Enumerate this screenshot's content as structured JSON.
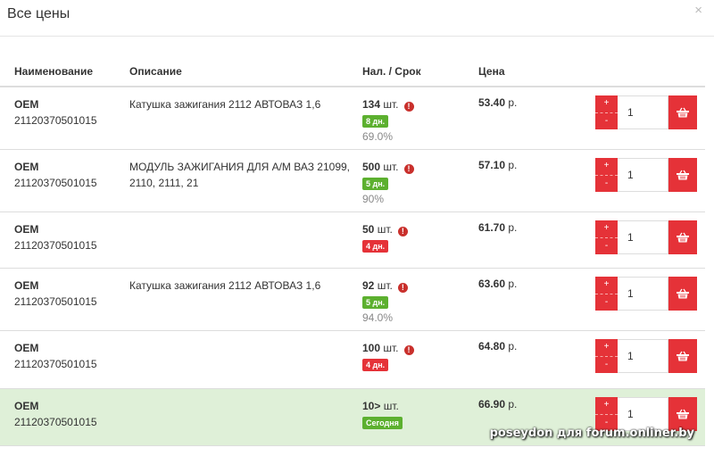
{
  "title": "Все цены",
  "close": "×",
  "headers": {
    "name": "Наименование",
    "desc": "Описание",
    "stock": "Нал. / Срок",
    "price": "Цена"
  },
  "colors": {
    "accent": "#e53238",
    "green": "#5cb02f",
    "red": "#e53238",
    "highlight": "#dff0d8"
  },
  "rows": [
    {
      "brand": "OEM",
      "code": "21120370501015",
      "desc": "Катушка зажигания 2112 АВТОВАЗ 1,6",
      "qty": "134",
      "unit": "шт.",
      "warn": true,
      "term": "8 дн.",
      "term_color": "#5cb02f",
      "pct": "69.0%",
      "price": "53.40",
      "cur": "р.",
      "amount": "1",
      "highlight": false
    },
    {
      "brand": "OEM",
      "code": "21120370501015",
      "desc": "МОДУЛЬ ЗАЖИГАНИЯ ДЛЯ А/М ВАЗ 21099, 2110, 2111, 21",
      "qty": "500",
      "unit": "шт.",
      "warn": true,
      "term": "5 дн.",
      "term_color": "#5cb02f",
      "pct": "90%",
      "price": "57.10",
      "cur": "р.",
      "amount": "1",
      "highlight": false
    },
    {
      "brand": "OEM",
      "code": "21120370501015",
      "desc": "",
      "qty": "50",
      "unit": "шт.",
      "warn": true,
      "term": "4 дн.",
      "term_color": "#e53238",
      "pct": "",
      "price": "61.70",
      "cur": "р.",
      "amount": "1",
      "highlight": false
    },
    {
      "brand": "OEM",
      "code": "21120370501015",
      "desc": "Катушка зажигания 2112 АВТОВАЗ 1,6",
      "qty": "92",
      "unit": "шт.",
      "warn": true,
      "term": "5 дн.",
      "term_color": "#5cb02f",
      "pct": "94.0%",
      "price": "63.60",
      "cur": "р.",
      "amount": "1",
      "highlight": false
    },
    {
      "brand": "OEM",
      "code": "21120370501015",
      "desc": "",
      "qty": "100",
      "unit": "шт.",
      "warn": true,
      "term": "4 дн.",
      "term_color": "#e53238",
      "pct": "",
      "price": "64.80",
      "cur": "р.",
      "amount": "1",
      "highlight": false
    },
    {
      "brand": "OEM",
      "code": "21120370501015",
      "desc": "",
      "qty": "10>",
      "unit": "шт.",
      "warn": false,
      "term": "Сегодня",
      "term_color": "#5cb02f",
      "pct": "",
      "price": "66.90",
      "cur": "р.",
      "amount": "1",
      "highlight": true
    }
  ],
  "plus": "+",
  "minus": "-",
  "watermark": "poseydon для forum.onliner.by"
}
